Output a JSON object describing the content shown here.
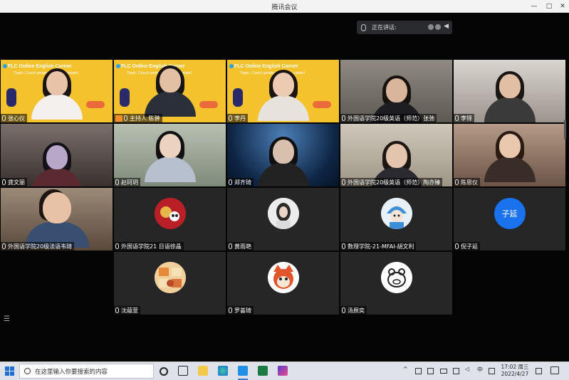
{
  "window": {
    "title": "腾讯会议",
    "minimize": "—",
    "maximize": "□",
    "close": "✕"
  },
  "speaking": {
    "label": "正在讲话:"
  },
  "banner": {
    "title": "FLC Online English Corner",
    "topic": "Topic: Couch potato, coach or potato!"
  },
  "participants": [
    {
      "name": "张心仪",
      "type": "banner"
    },
    {
      "name": "主持人 陈翀",
      "type": "banner",
      "host": true
    },
    {
      "name": "李丹",
      "type": "banner"
    },
    {
      "name": "外国语学院20级英语（师范）张弛",
      "type": "video"
    },
    {
      "name": "李铎",
      "type": "video"
    },
    {
      "name": "龚文丽",
      "type": "video"
    },
    {
      "name": "赵珂玥",
      "type": "video"
    },
    {
      "name": "郑齐琦",
      "type": "video"
    },
    {
      "name": "外国语学院20级英语（师范）陶亦臻",
      "type": "video"
    },
    {
      "name": "陈思仪",
      "type": "video"
    },
    {
      "name": "外国语学院20级法语韦琦",
      "type": "video"
    },
    {
      "name": "外国语学院21 日语徐晶",
      "type": "avatar"
    },
    {
      "name": "黄雨艳",
      "type": "avatar"
    },
    {
      "name": "数理学院-21-MFAI-胡文利",
      "type": "avatar"
    },
    {
      "name": "倪子延",
      "type": "avatar",
      "avatar_text": "子延"
    },
    {
      "name": "沈蕴萱",
      "type": "avatar"
    },
    {
      "name": "罗荟琦",
      "type": "avatar"
    },
    {
      "name": "汤辰奕",
      "type": "avatar"
    }
  ],
  "taskbar": {
    "search_placeholder": "在这里输入你要搜索的内容",
    "tray_ime": "中",
    "time": "17:02 周三",
    "date": "2022/4/27"
  },
  "colors": {
    "banner_yellow": "#f3c22d",
    "avatar_blue": "#1a72ee",
    "taskbar": "#dfe3e9"
  }
}
